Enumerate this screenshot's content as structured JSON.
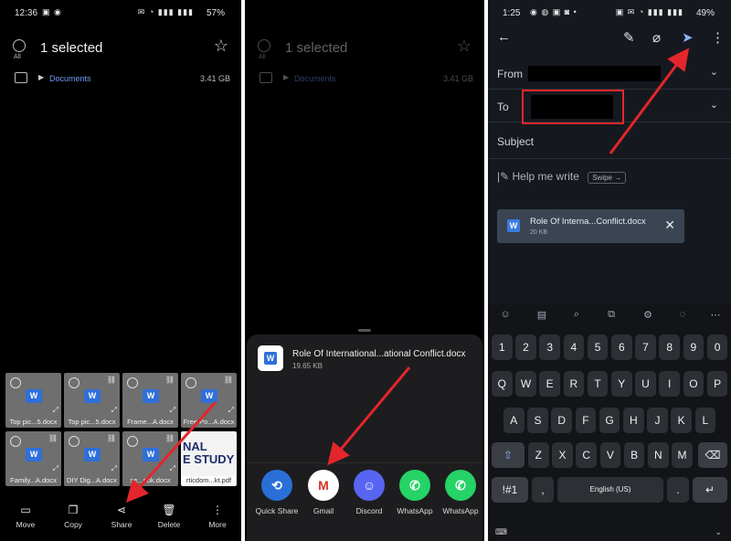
{
  "panel1": {
    "status": {
      "time": "12:36",
      "battery": "57%"
    },
    "header": {
      "title": "1 selected",
      "all_label": "All"
    },
    "path": {
      "folder": "Documents",
      "size": "3.41 GB"
    },
    "files": [
      {
        "name": "Top pic...5.docx"
      },
      {
        "name": "Top pic...5.docx"
      },
      {
        "name": "Frame...A.docx"
      },
      {
        "name": "Free Po...A.docx"
      },
      {
        "name": "Family...A.docx"
      },
      {
        "name": "DIY Dig...A.docx"
      },
      {
        "name": "se...ook.docx"
      },
      {
        "name": "rticdom...kt.pdf",
        "thumbnail_text": "NAL\nE STUDY"
      }
    ],
    "actions": [
      {
        "label": "Move",
        "icon": "move-icon"
      },
      {
        "label": "Copy",
        "icon": "copy-icon"
      },
      {
        "label": "Share",
        "icon": "share-icon"
      },
      {
        "label": "Delete",
        "icon": "delete-icon"
      },
      {
        "label": "More",
        "icon": "more-icon"
      }
    ]
  },
  "panel2": {
    "header": {
      "title": "1 selected"
    },
    "path": {
      "folder": "Documents",
      "size": "3.41 GB"
    },
    "share_file": {
      "name": "Role Of International...ational Conflict.docx",
      "size": "19.65 KB"
    },
    "apps": [
      {
        "label": "Quick Share",
        "color": "#2a6fd8"
      },
      {
        "label": "Gmail",
        "color": "#ffffff"
      },
      {
        "label": "Discord",
        "color": "#5865f2"
      },
      {
        "label": "WhatsApp",
        "color": "#25d366"
      },
      {
        "label": "WhatsApp",
        "color": "#25d366"
      }
    ]
  },
  "panel3": {
    "status": {
      "time": "1:25",
      "battery": "49%"
    },
    "fields": {
      "from": "From",
      "to": "To",
      "subject": "Subject"
    },
    "help": {
      "text": "Help me write",
      "swipe": "Swipe →"
    },
    "attachment": {
      "name": "Role Of Interna...Conflict.docx",
      "size": "20 KB"
    },
    "keyboard": {
      "row0": [
        "1",
        "2",
        "3",
        "4",
        "5",
        "6",
        "7",
        "8",
        "9",
        "0"
      ],
      "row1": [
        "Q",
        "W",
        "E",
        "R",
        "T",
        "Y",
        "U",
        "I",
        "O",
        "P"
      ],
      "row2": [
        "A",
        "S",
        "D",
        "F",
        "G",
        "H",
        "J",
        "K",
        "L"
      ],
      "row3": [
        "Z",
        "X",
        "C",
        "V",
        "B",
        "N",
        "M"
      ],
      "symbols": "!#1",
      "space": "English (US)",
      "comma": ",",
      "period": ".",
      "enter": "↵",
      "backspace": "⌫",
      "shift": "⇧"
    }
  },
  "colors": {
    "accent_blue": "#6f9df5",
    "annotation_red": "#e3262b"
  }
}
